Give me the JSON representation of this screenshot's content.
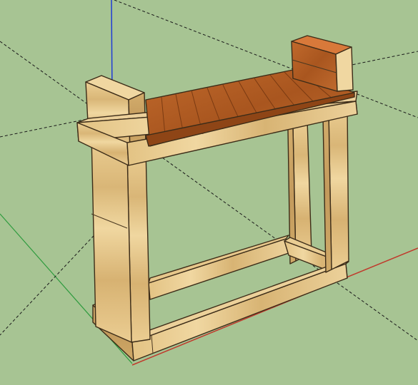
{
  "canvas": {
    "background_color": "#a7c493",
    "axes": {
      "red_axis_color": "#c0392b",
      "green_axis_color": "#2e9b3e",
      "blue_axis_color": "#1f3bd6",
      "inference_line_color": "#1a1a1a"
    }
  },
  "model": {
    "wood_light_color": "#e8c98a",
    "wood_shadow_color": "#c9a469",
    "slat_color": "#b4602a",
    "slat_dark_color": "#8e4516"
  }
}
